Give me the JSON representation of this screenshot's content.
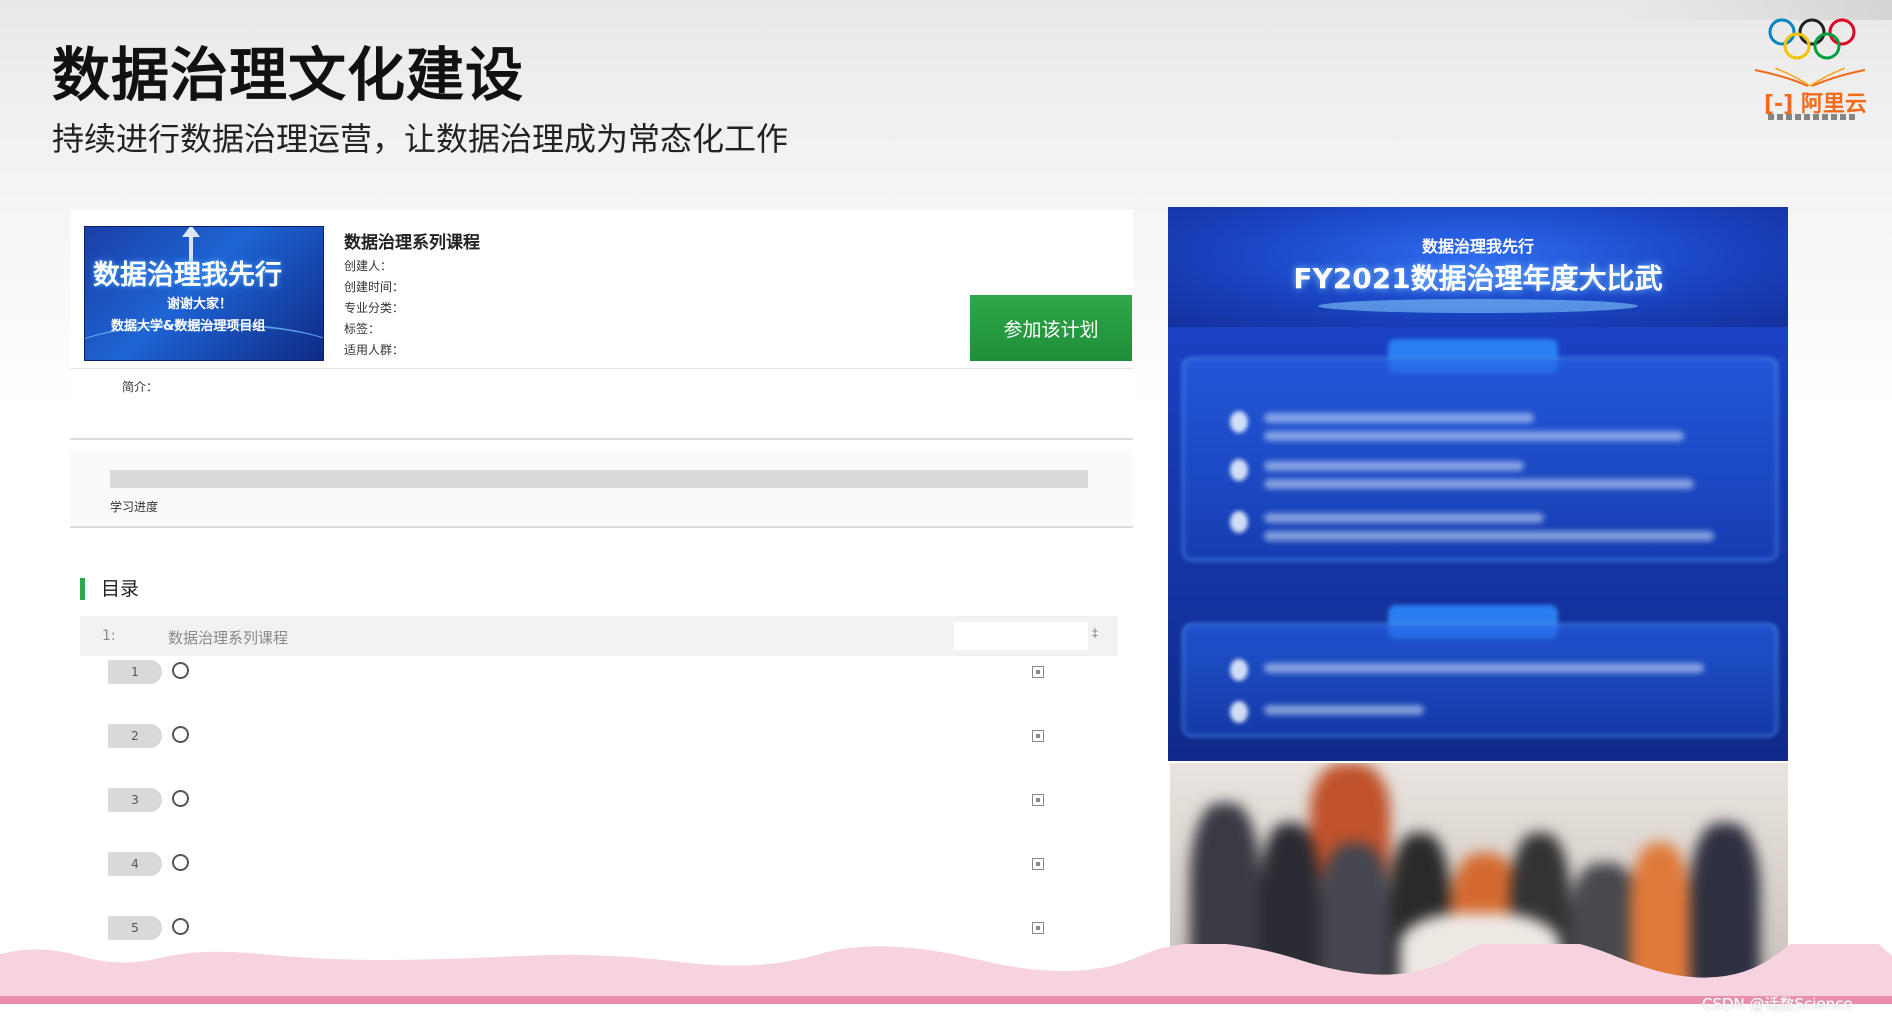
{
  "slide": {
    "title": "数据治理文化建设",
    "subtitle": "持续进行数据治理运营，让数据治理成为常态化工作"
  },
  "logo": {
    "brand": "阿里云",
    "icon": "olympic-rings-icon"
  },
  "course": {
    "banner": {
      "line1": "数据治理我先行",
      "line2": "谢谢大家！",
      "line3": "数据大学&数据治理项目组"
    },
    "name": "数据治理系列课程",
    "meta": {
      "creator_label": "创建人：",
      "created_time_label": "创建时间：",
      "category_label": "专业分类：",
      "tags_label": "标签：",
      "audience_label": "适用人群："
    },
    "join_label": "参加该计划",
    "intro_label": "简介：",
    "progress_label": "学习进度",
    "progress_fraction": 0,
    "accent_color": "#2fa74a"
  },
  "toc": {
    "header": "目录",
    "chapter": {
      "index": "1:",
      "title": "数据治理系列课程",
      "caret": "‡"
    },
    "lessons": [
      {
        "number": "1"
      },
      {
        "number": "2"
      },
      {
        "number": "3"
      },
      {
        "number": "4"
      },
      {
        "number": "5"
      }
    ]
  },
  "event_panel": {
    "subtitle": "数据治理我先行",
    "title": "FY2021数据治理年度大比武",
    "accent_color": "#1b43c6"
  },
  "watermark": "CSDN @话数Science"
}
